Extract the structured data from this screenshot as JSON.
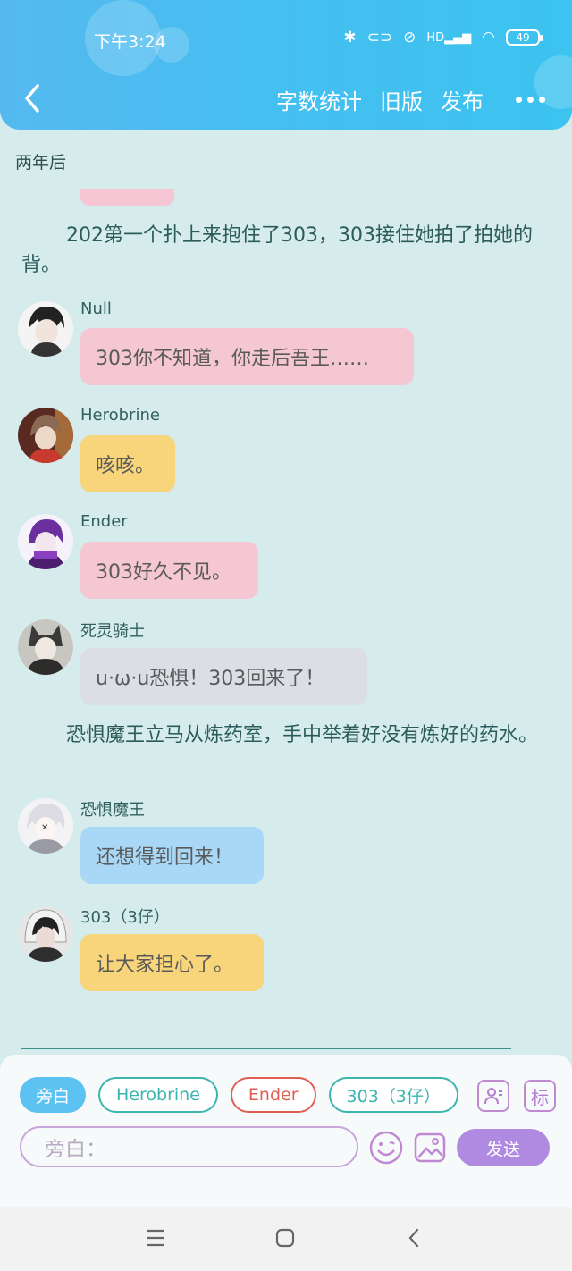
{
  "status_bar": {
    "time": "下午3:24",
    "battery": "49",
    "hd": "HD"
  },
  "toolbar": {
    "word_count": "字数统计",
    "old_version": "旧版",
    "publish": "发布"
  },
  "chapter_title": "两年后",
  "narrations": [
    "202第一个扑上来抱住了303，303接住她拍了拍她的背。",
    "恐惧魔王立马从炼药室，手中举着好没有炼好的药水。"
  ],
  "messages": [
    {
      "name": "Null",
      "text": "303你不知道，你走后吾王……",
      "color": "#f5c7d3"
    },
    {
      "name": "Herobrine",
      "text": "咳咳。",
      "color": "#f8d57a"
    },
    {
      "name": "Ender",
      "text": "303好久不见。",
      "color": "#f5c7d3"
    },
    {
      "name": "死灵骑士",
      "text": "u·ω·u恐惧！303回来了！",
      "color": "#dcdee5"
    },
    {
      "name": "恐惧魔王",
      "text": "还想得到回来！",
      "color": "#a9d8f6"
    },
    {
      "name": "303（3仔）",
      "text": "让大家担心了。",
      "color": "#f8d57a"
    }
  ],
  "role_chips": [
    {
      "label": "旁白",
      "color": "#5cc2f2"
    },
    {
      "label": "Herobrine",
      "color": "#3bb5ae"
    },
    {
      "label": "Ender",
      "color": "#e05f55"
    },
    {
      "label": "303（3仔）",
      "color": "#3bb5ae"
    }
  ],
  "tools": {
    "mark_label": "标"
  },
  "input": {
    "placeholder": "旁白："
  },
  "send_label": "发送"
}
